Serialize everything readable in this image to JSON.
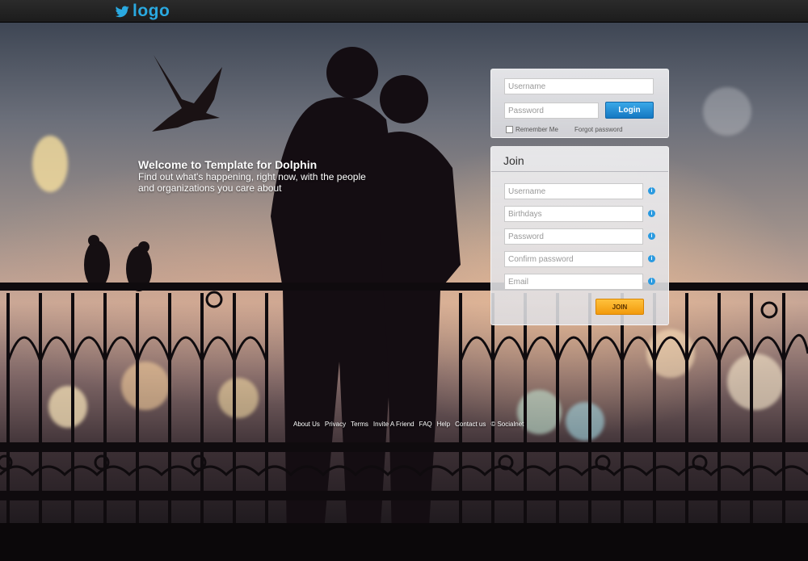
{
  "header": {
    "logo_text": "logo",
    "logo_icon": "twitter-bird-icon",
    "accent": "#2aa9e0"
  },
  "welcome": {
    "title": "Welcome to Template for Dolphin",
    "line1": "Find out what's happening, right now, with the people",
    "line2": "and organizations you care about"
  },
  "login": {
    "username_placeholder": "Username",
    "password_placeholder": "Password",
    "login_label": "Login",
    "remember_label": "Remember Me",
    "forgot_label": "Forgot password",
    "button_color": "#1a85cf"
  },
  "join": {
    "title": "Join",
    "fields": [
      {
        "placeholder": "Username"
      },
      {
        "placeholder": "Birthdays"
      },
      {
        "placeholder": "Password"
      },
      {
        "placeholder": "Confirm password"
      },
      {
        "placeholder": "Email"
      }
    ],
    "info_icon": "info-icon",
    "join_label": "JOIN",
    "button_color": "#f7a81d"
  },
  "footer": {
    "links": [
      "About Us",
      "Privacy",
      "Terms",
      "Invite A Friend",
      "FAQ",
      "Help",
      "Contact us",
      "© Socialnet"
    ]
  }
}
